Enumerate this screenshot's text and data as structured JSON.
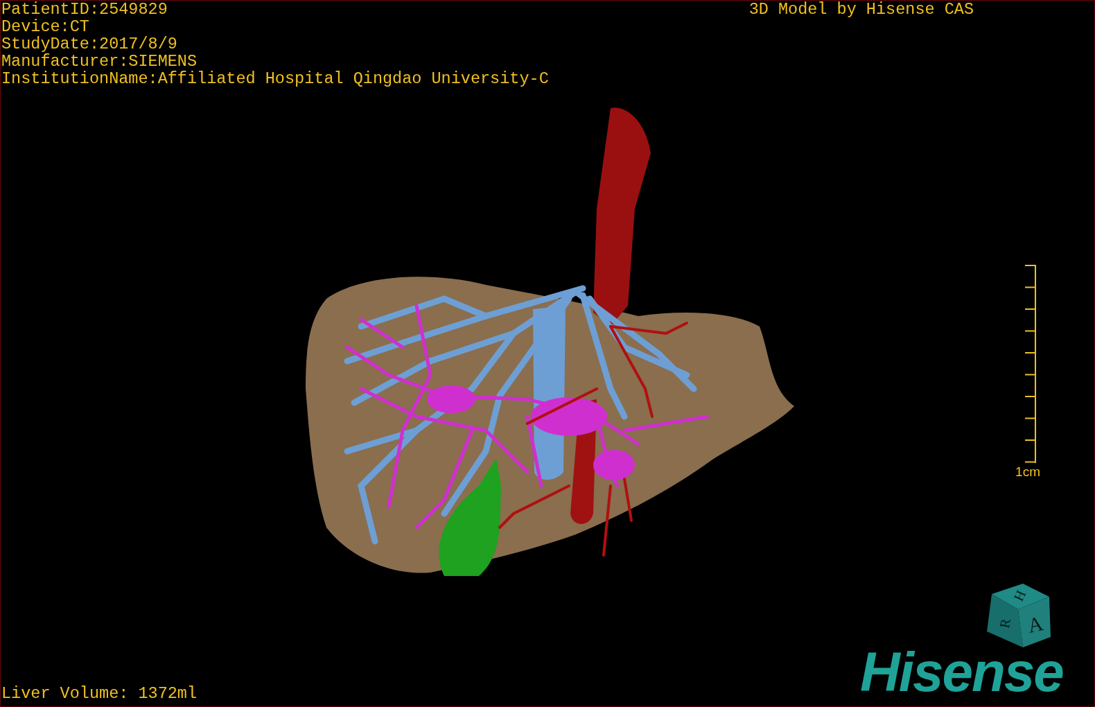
{
  "overlay": {
    "patient_info": [
      "PatientID:2549829",
      "Device:CT",
      "StudyDate:2017/8/9",
      "Manufacturer:SIEMENS",
      "InstitutionName:Affiliated Hospital Qingdao University-C"
    ],
    "title": "3D Model by Hisense CAS",
    "volume": "Liver Volume: 1372ml"
  },
  "scale_bar": {
    "label": "1cm"
  },
  "orientation_cube": {
    "faces": [
      "H",
      "R",
      "A"
    ]
  },
  "logo": "Hisense"
}
